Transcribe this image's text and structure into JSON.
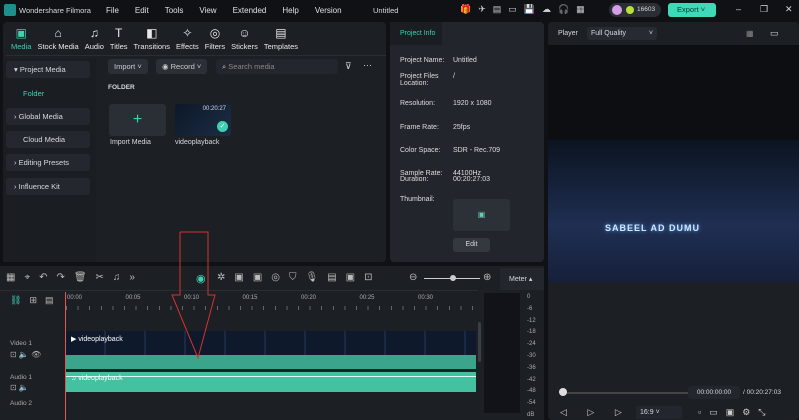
{
  "app": {
    "name": "Wondershare Filmora",
    "title": "Untitled",
    "menu": [
      "File",
      "Edit",
      "Tools",
      "View",
      "Extended",
      "Help",
      "Version"
    ],
    "credits": "16603",
    "export_label": "Export"
  },
  "tabs": [
    {
      "label": "Media",
      "icon": "media-icon"
    },
    {
      "label": "Stock Media",
      "icon": "stock-icon"
    },
    {
      "label": "Audio",
      "icon": "music-icon"
    },
    {
      "label": "Titles",
      "icon": "text-icon"
    },
    {
      "label": "Transitions",
      "icon": "transition-icon"
    },
    {
      "label": "Effects",
      "icon": "effects-icon"
    },
    {
      "label": "Filters",
      "icon": "filter-icon"
    },
    {
      "label": "Stickers",
      "icon": "sticker-icon"
    },
    {
      "label": "Templates",
      "icon": "template-icon"
    }
  ],
  "sidebar": {
    "items": [
      "Project Media",
      "Folder",
      "Global Media",
      "Cloud Media",
      "Editing Presets",
      "Influence Kit"
    ]
  },
  "media": {
    "import_label": "Import",
    "record_label": "Record",
    "search_placeholder": "Search media",
    "folder_heading": "FOLDER",
    "import_media_label": "Import Media",
    "clip_name": "videoplayback",
    "clip_duration": "00:20:27"
  },
  "project_info": {
    "tab": "Project Info",
    "rows": [
      {
        "label": "Project Name:",
        "value": "Untitled"
      },
      {
        "label": "Project Files Location:",
        "value": "/"
      },
      {
        "label": "Resolution:",
        "value": "1920 x 1080"
      },
      {
        "label": "Frame Rate:",
        "value": "25fps"
      },
      {
        "label": "Color Space:",
        "value": "SDR - Rec.709"
      },
      {
        "label": "Sample Rate:",
        "value": "44100Hz"
      },
      {
        "label": "Duration:",
        "value": "00:20:27:03"
      }
    ],
    "thumbnail_label": "Thumbnail:",
    "edit_label": "Edit"
  },
  "player": {
    "label": "Player",
    "quality": "Full Quality",
    "overlay_text": "SABEEL AD DUMU",
    "current_time": "00:00:00:00",
    "total_time": "/ 00:20:27:03",
    "aspect": "16:9",
    "progress": 0
  },
  "timeline": {
    "ticks": [
      "00:00",
      "00:05",
      "00:10",
      "00:15",
      "00:20",
      "00:25",
      "00:30"
    ],
    "meter_label": "Meter",
    "meter_scale": [
      "0",
      "-6",
      "-12",
      "-18",
      "-24",
      "-30",
      "-36",
      "-42",
      "-48",
      "-54",
      "dB"
    ],
    "tracks": [
      {
        "name": "Video 1",
        "clip": "videoplayback"
      },
      {
        "name": "Audio 1",
        "clip": "videoplayback"
      },
      {
        "name": "Audio 2"
      }
    ]
  },
  "colors": {
    "accent": "#3fd1b0",
    "clip": "#3aa58a",
    "annotation": "#d9322e"
  }
}
